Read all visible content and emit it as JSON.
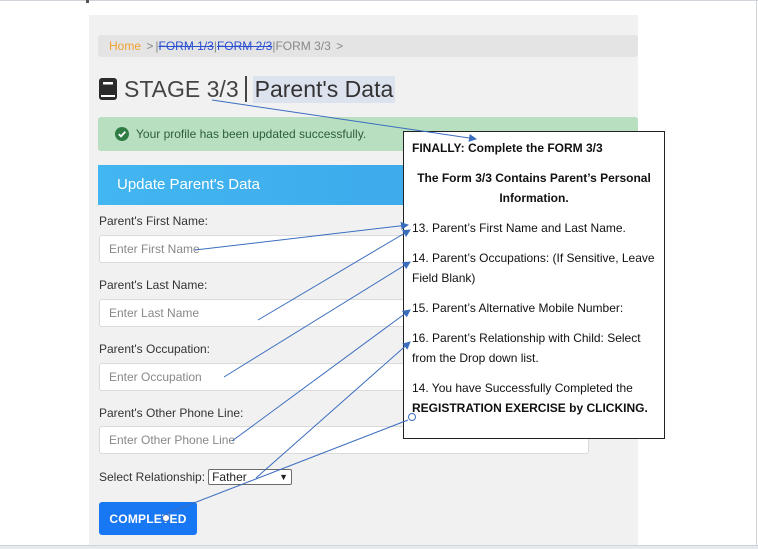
{
  "breadcrumb": {
    "home": "Home",
    "sep": ">",
    "form1": "FORM 1/3",
    "form2": "FORM 2/3",
    "current": "FORM 3/3",
    "sep_end": ">"
  },
  "stage": {
    "title": "STAGE 3/3",
    "subtitle": "Parent's Data"
  },
  "alert": {
    "message": "Your profile has been updated successfully."
  },
  "panel": {
    "title": "Update Parent's Data"
  },
  "form": {
    "first_name_label": "Parent's First Name:",
    "first_name_placeholder": "Enter First Name",
    "last_name_label": "Parent's Last Name:",
    "last_name_placeholder": "Enter Last Name",
    "occupation_label": "Parent's Occupation:",
    "occupation_placeholder": "Enter Occupation",
    "phone_label": "Parent's Other Phone Line:",
    "phone_placeholder": "Enter Other Phone Line",
    "relationship_label": "Select Relationship:",
    "relationship_value": "Father",
    "submit_label": "COMPLETED"
  },
  "callout": {
    "heading": "FINALLY: Complete the FORM 3/3",
    "intro": "The Form 3/3 Contains Parent’s Personal Information.",
    "item13": "13.  Parent’s First Name and Last Name.",
    "item14": "14. Parent’s Occupations: (If Sensitive, Leave Field Blank)",
    "item15": "15. Parent’s Alternative Mobile Number:",
    "item16": "16. Parent’s Relationship with Child: Select from the Drop down list.",
    "item17_prefix": "14. You have Successfully Completed the",
    "item17_bold": "REGISTRATION EXERCISE by CLICKING."
  },
  "colors": {
    "accent_blue": "#1877f2",
    "panel_header": "#42b6f0",
    "alert_green": "#b7dfc0",
    "breadcrumb_home": "#f0a030",
    "arrow": "#3b6dbf"
  },
  "icons": [
    "book-icon",
    "check-circle-icon",
    "chevron-down-icon"
  ]
}
